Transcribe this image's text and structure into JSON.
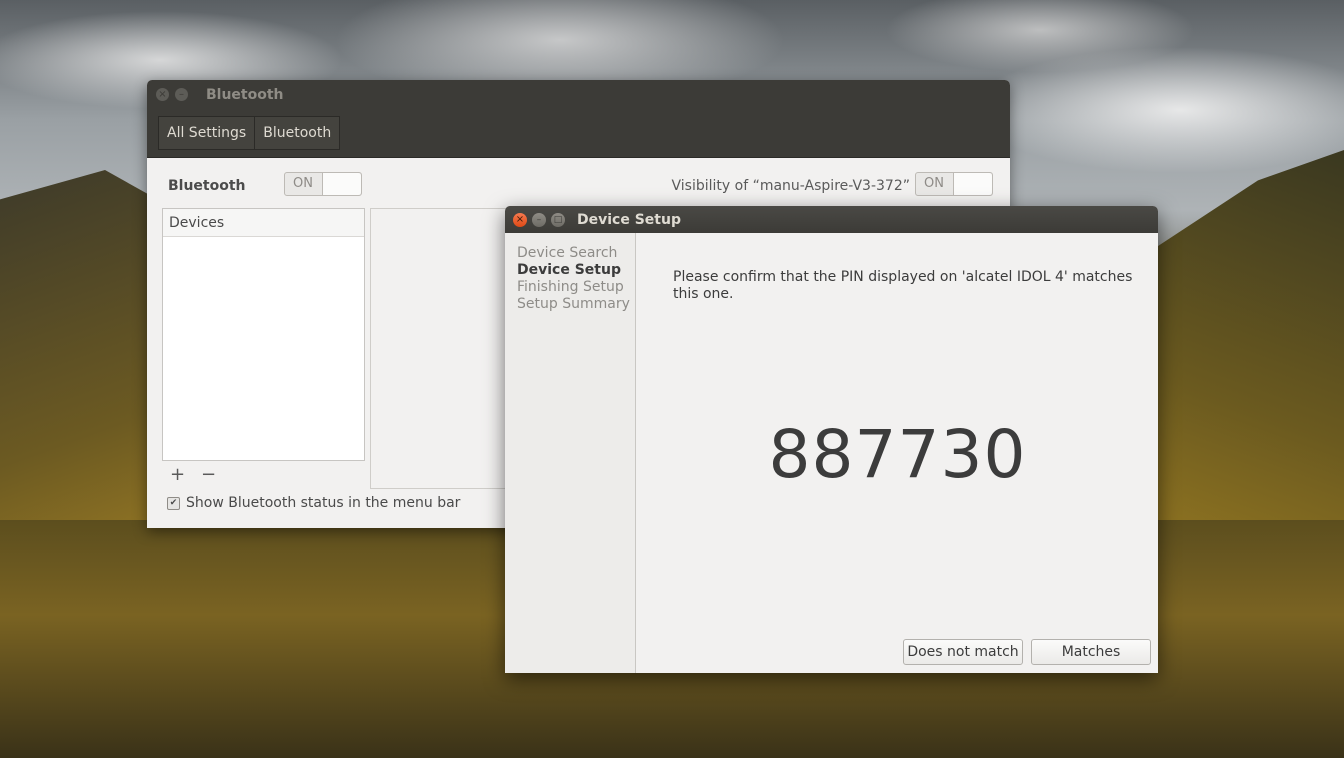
{
  "bluetooth_window": {
    "title": "Bluetooth",
    "breadcrumbs": [
      "All Settings",
      "Bluetooth"
    ],
    "bluetooth_label": "Bluetooth",
    "bluetooth_switch": "ON",
    "visibility_label": "Visibility of “manu-Aspire-V3-372”",
    "visibility_switch": "ON",
    "devices_header": "Devices",
    "add_symbol": "+",
    "remove_symbol": "−",
    "show_status_label": "Show Bluetooth status in the menu bar",
    "show_status_checked": true
  },
  "device_setup": {
    "title": "Device Setup",
    "steps": [
      {
        "label": "Device Search",
        "current": false
      },
      {
        "label": "Device Setup",
        "current": true
      },
      {
        "label": "Finishing Setup",
        "current": false
      },
      {
        "label": "Setup Summary",
        "current": false
      }
    ],
    "message": "Please confirm that the PIN displayed on 'alcatel IDOL 4' matches this one.",
    "pin": "887730",
    "buttons": {
      "does_not_match": "Does not match",
      "matches": "Matches"
    }
  },
  "colors": {
    "titlebar": "#3c3b37",
    "window_bg": "#f2f1f0",
    "close_button": "#df4a16"
  },
  "icons": [
    "close-icon",
    "minimize-icon",
    "maximize-icon",
    "checkbox-checked-icon",
    "add-icon",
    "remove-icon"
  ]
}
